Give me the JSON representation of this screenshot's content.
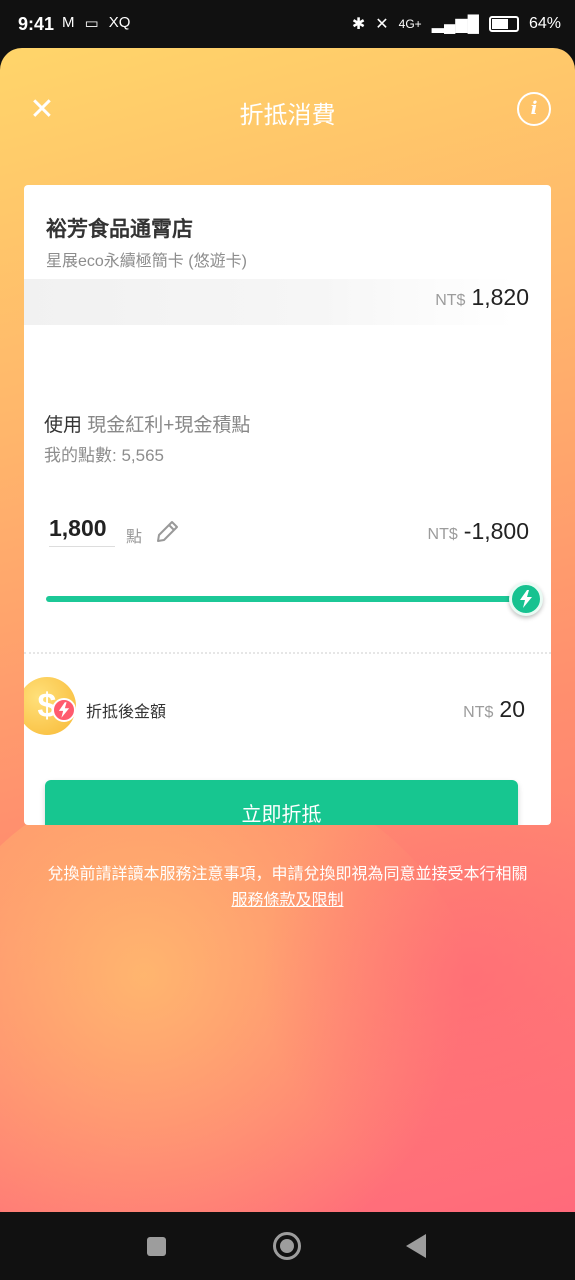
{
  "status_bar": {
    "time": "9:41",
    "left_icons": [
      "mail-icon",
      "vr-icon",
      "xq-icon"
    ],
    "left_text": [
      "M",
      "▭",
      "XQ"
    ],
    "network": "4G+",
    "battery": "64%"
  },
  "header": {
    "title": "折抵消費",
    "close_icon": "close-icon",
    "info_icon": "info-icon"
  },
  "card": {
    "store_name": "裕芳食品通霄店",
    "card_name": "星展eco永續極簡卡 (悠遊卡)",
    "amount_currency": "NT$",
    "amount": "1,820",
    "use_label": "使用",
    "use_value": "現金紅利+現金積點",
    "my_points": "我的點數: 5,565",
    "points_input": "1,800",
    "points_unit": "點",
    "deduct_currency": "NT$",
    "deduct_amount": "-1,800",
    "slider_level": 1.0,
    "after_label": "折抵後金額",
    "after_currency": "NT$",
    "after_amount": "20",
    "submit_label": "立即折抵"
  },
  "notice": {
    "text": "兌換前請詳讀本服務注意事項，申請兌換即視為同意並接受本行相關",
    "link": "服務條款及限制"
  },
  "colors": {
    "accent": "#17c690",
    "badge": "#ff5b6e",
    "coin": "#f8b935"
  }
}
